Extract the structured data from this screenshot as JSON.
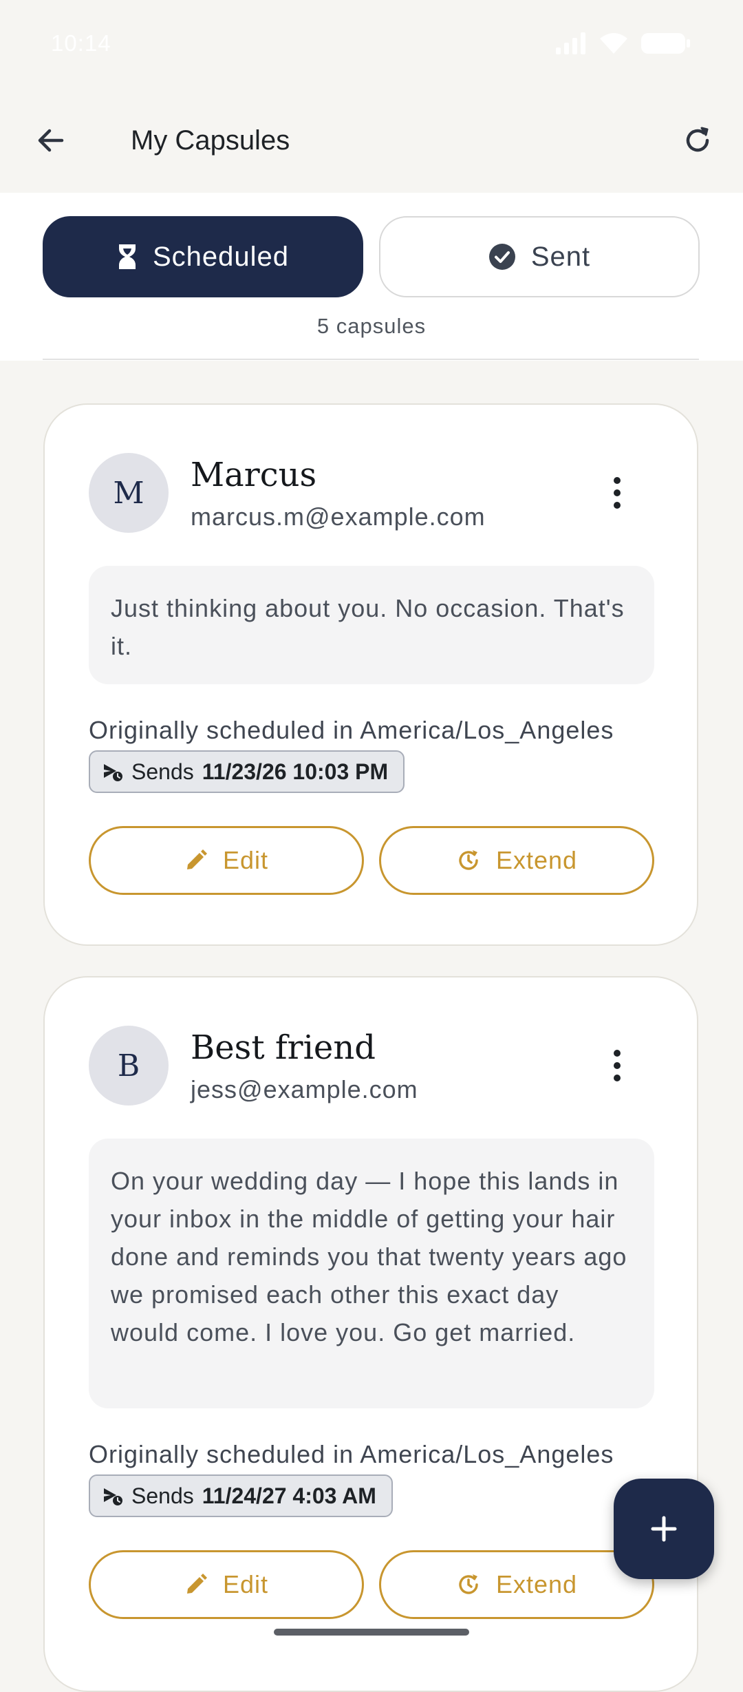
{
  "status_bar": {
    "time": "10:14"
  },
  "app_bar": {
    "title": "My Capsules"
  },
  "tabs": [
    {
      "label": "Scheduled",
      "icon": "hourglass-icon",
      "selected": true
    },
    {
      "label": "Sent",
      "icon": "check-circle-icon",
      "selected": false
    }
  ],
  "count_label": "5 capsules",
  "capsules": [
    {
      "avatar_initial": "M",
      "name": "Marcus",
      "email": "marcus.m@example.com",
      "message": "Just thinking about you. No occasion. That's it.",
      "timezone_note": "Originally scheduled in America/Los_Angeles",
      "send_prefix": "Sends",
      "send_time": "11/23/26 10:03 PM",
      "edit_label": "Edit",
      "extend_label": "Extend"
    },
    {
      "avatar_initial": "B",
      "name": "Best friend",
      "email": "jess@example.com",
      "message": "On your wedding day — I hope this lands in your inbox in the middle of getting your hair done and reminds you that twenty years ago we promised each other this exact day would come. I love you. Go get married.",
      "timezone_note": "Originally scheduled in America/Los_Angeles",
      "send_prefix": "Sends",
      "send_time": "11/24/27 4:03 AM",
      "edit_label": "Edit",
      "extend_label": "Extend"
    }
  ],
  "colors": {
    "primary": "#1E2A4A",
    "accent": "#C8962F",
    "background": "#F6F5F2",
    "card": "#FFFFFF"
  }
}
